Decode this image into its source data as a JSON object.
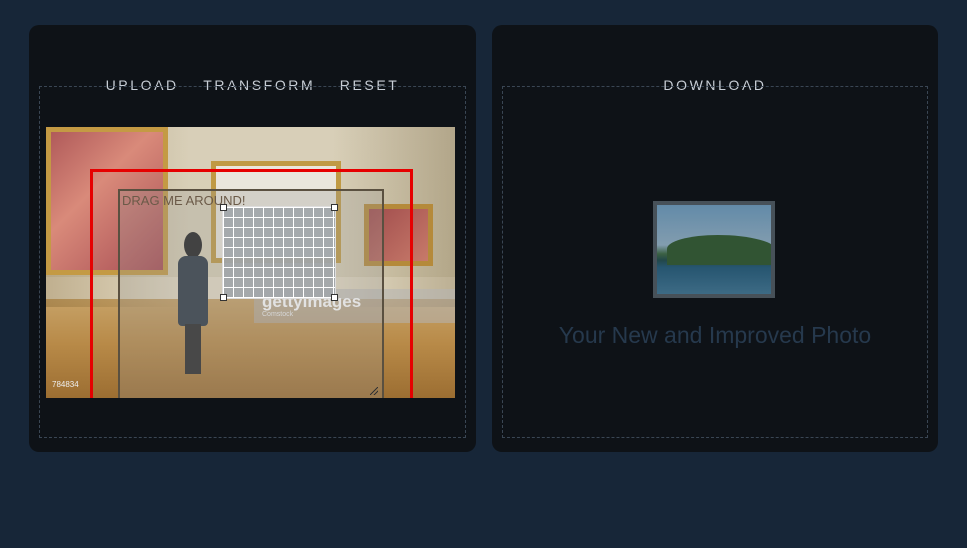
{
  "left_panel": {
    "nav": {
      "upload_label": "UPLOAD",
      "transform_label": "TRANSFORM",
      "reset_label": "RESET"
    },
    "overlay": {
      "drag_label": "DRAG ME AROUND!"
    },
    "photo": {
      "watermark_logo": "gettyimages",
      "watermark_sub": "Comstock",
      "photo_id": "784834"
    }
  },
  "right_panel": {
    "nav": {
      "download_label": "DOWNLOAD"
    },
    "placeholder_text": "Your New and Improved Photo"
  },
  "colors": {
    "background": "#172638",
    "panel": "#0e1217",
    "nav_text": "#c8ced6",
    "crop_frame": "#e60000",
    "placeholder_text": "#26394d"
  }
}
